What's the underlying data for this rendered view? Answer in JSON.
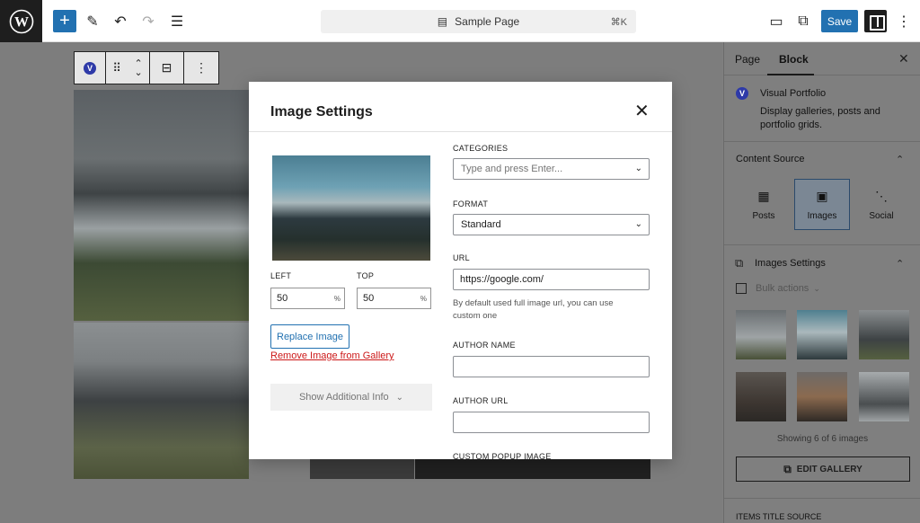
{
  "topbar": {
    "document_title": "Sample Page",
    "shortcut": "⌘K",
    "save_label": "Save",
    "accent": "#2271b1"
  },
  "sidebar": {
    "tabs": [
      {
        "label": "Page"
      },
      {
        "label": "Block"
      }
    ],
    "block": {
      "title": "Visual Portfolio",
      "description": "Display galleries, posts and portfolio grids."
    },
    "content_source": {
      "title": "Content Source",
      "options": [
        {
          "label": "Posts",
          "icon": "posts-icon"
        },
        {
          "label": "Images",
          "icon": "images-icon",
          "active": true
        },
        {
          "label": "Social",
          "icon": "share-icon"
        }
      ]
    },
    "images_settings": {
      "title": "Images Settings",
      "bulk_actions": "Bulk actions",
      "showing": "Showing 6 of 6 images",
      "edit_gallery": "EDIT GALLERY"
    },
    "items_title_source": "ITEMS TITLE SOURCE"
  },
  "modal": {
    "title": "Image Settings",
    "left_label": "LEFT",
    "left_value": "50",
    "top_label": "TOP",
    "top_value": "50",
    "percent": "%",
    "replace_label": "Replace Image",
    "remove_label": "Remove Image from Gallery",
    "additional_label": "Show Additional Info",
    "categories_label": "CATEGORIES",
    "categories_placeholder": "Type and press Enter...",
    "format_label": "FORMAT",
    "format_value": "Standard",
    "url_label": "URL",
    "url_value": "https://google.com/",
    "url_help": "By default used full image url, you can use custom one",
    "author_name_label": "AUTHOR NAME",
    "author_url_label": "AUTHOR URL",
    "custom_popup_label": "CUSTOM POPUP IMAGE"
  }
}
